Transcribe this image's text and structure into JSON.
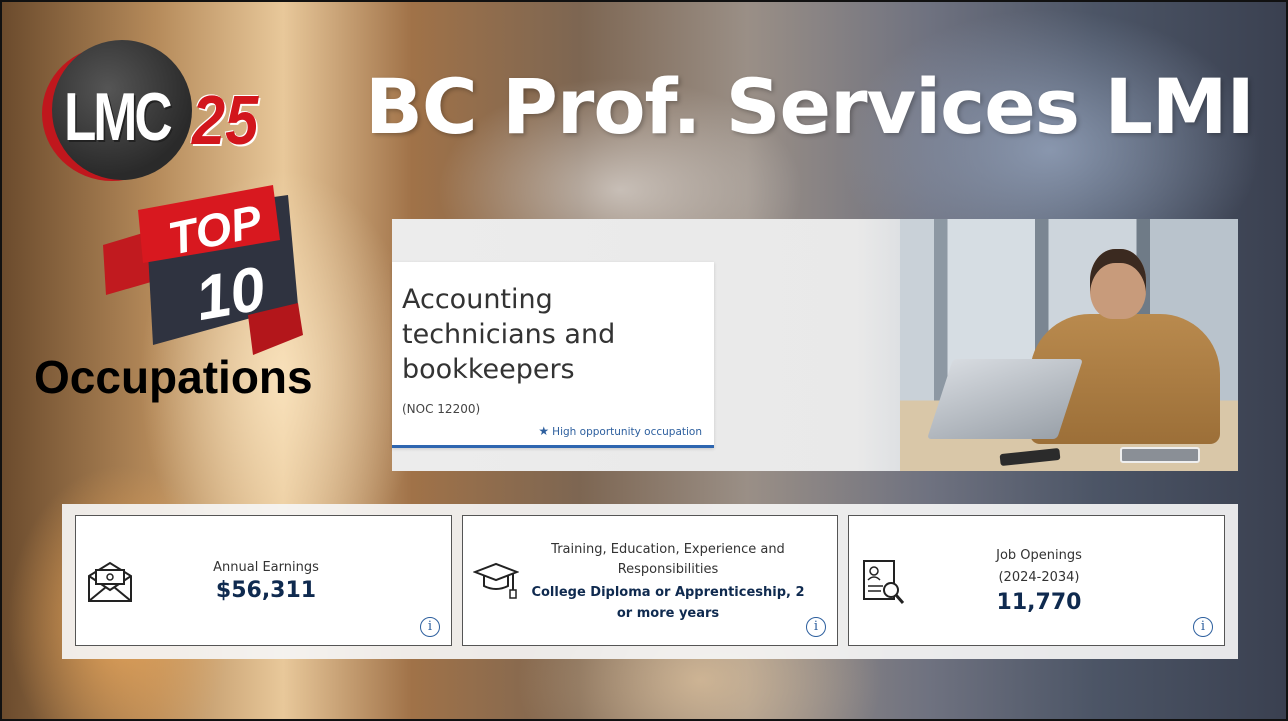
{
  "logo": {
    "lmc_text": "LMC",
    "lmc_number": "25"
  },
  "title": "BC Prof. Services LMI",
  "badge": {
    "top_text": "TOP",
    "number_text": "10"
  },
  "subtitle": "Occupations",
  "occupation": {
    "title": "Accounting technicians and bookkeepers",
    "noc": "(NOC 12200)",
    "tag": "High opportunity occupation"
  },
  "stats": {
    "earnings": {
      "label": "Annual Earnings",
      "value": "$56,311"
    },
    "training": {
      "label": "Training, Education, Experience and Responsibilities",
      "value": "College Diploma or Apprenticeship, 2 or more years"
    },
    "openings": {
      "label": "Job Openings",
      "period": "(2024-2034)",
      "value": "11,770"
    }
  },
  "colors": {
    "accent_blue": "#2e66b0",
    "value_navy": "#0f2a4f",
    "badge_red": "#d2161c"
  }
}
